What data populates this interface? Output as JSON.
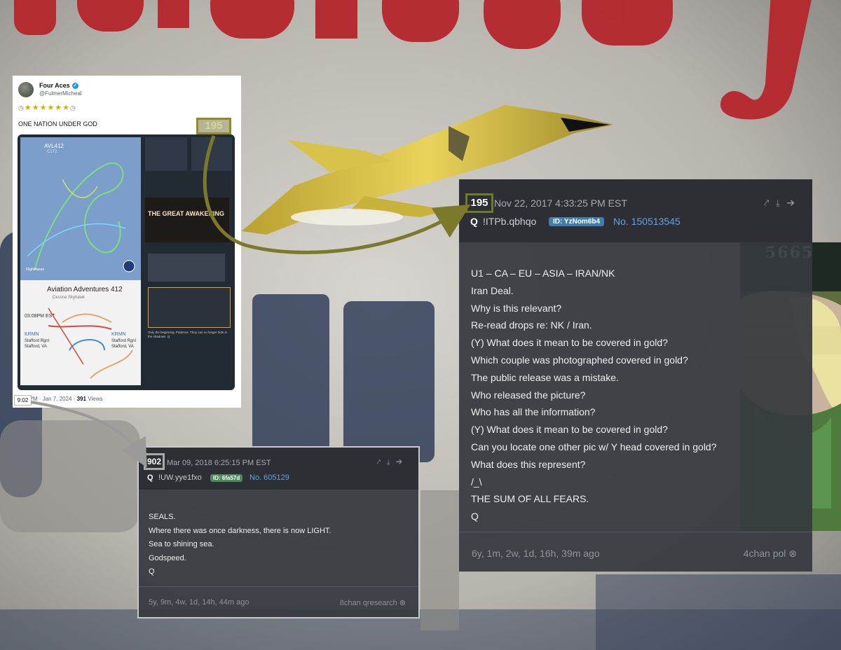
{
  "tweet": {
    "display_name": "Four Aces",
    "handle": "@FulmerMicheal",
    "stars": "★★★★★★",
    "text": "ONE NATION UNDER GOD",
    "time_tag": "9:02",
    "meta_rest": "PM · Jan 7, 2024 · ",
    "views_count": "391",
    "views_label": " Views",
    "media": {
      "map_code": "AVL412",
      "map_sub": "C172",
      "map_brand": "FlightAware",
      "route_title": "Aviation Adventures 412",
      "route_sub": "Cessna Skyhawk",
      "route_lines": [
        "03:08PM EST",
        "KRMN",
        "Stafford Rgnl",
        "Stafford, VA",
        "KRMN",
        "Stafford Rgnl",
        "Stafford, VA"
      ],
      "awakening_title": "THE GREAT AWAKENING",
      "note": "Only the beginning. Patience. They can no longer hide in the shadows. Q"
    }
  },
  "post_195": {
    "number": "195",
    "date": "Nov 22, 2017 4:33:25 PM EST",
    "q": "Q",
    "trip": "!ITPb.qbhqo",
    "id": "ID: YzNom6b4",
    "no": "No. 150513545",
    "tools": "⤤ ⤓ ➔",
    "lines": [
      "U1 – CA – EU – ASIA – IRAN/NK",
      "Iran Deal.",
      "Why is this relevant?",
      "Re-read drops re: NK / Iran.",
      "(Y) What does it mean to be covered in gold?",
      "Which couple was photographed covered in gold?",
      "The public release was a mistake.",
      "Who released the picture?",
      "Who has all the information?",
      "(Y) What does it mean to be covered in gold?",
      "Can you locate one other pic w/ Y head covered in gold?",
      "What does this represent?",
      "/_\\",
      "THE SUM OF ALL FEARS.",
      "Q"
    ],
    "ago": "6y, 1m, 2w, 1d, 16h, 39m ago",
    "source": "4chan pol ⊗"
  },
  "post_902": {
    "number": "902",
    "date": "Mar 09, 2018 6:25:15 PM EST",
    "q": "Q",
    "trip": "!UW.yye1fxo",
    "id": "ID: 6fa57d",
    "no": "No. 605129",
    "tools": "⤤ ⤓ ➔",
    "lines": [
      "SEALS.",
      "Where there was once darkness, there is now LIGHT.",
      "Sea to shining sea.",
      "Godspeed.",
      "Q"
    ],
    "ago": "5y, 9m, 4w, 1d, 14h, 44m ago",
    "source": "8chan qresearch ⊗"
  },
  "overlay_tag": "195",
  "face_label": "5665",
  "colors": {
    "tag_olive": "#8f8b2c",
    "arrow_olive": "#7b7a2a",
    "arrow_grey": "#9a9a9a",
    "link_blue": "#5ea4e6",
    "letters_red": "#b5262c"
  }
}
